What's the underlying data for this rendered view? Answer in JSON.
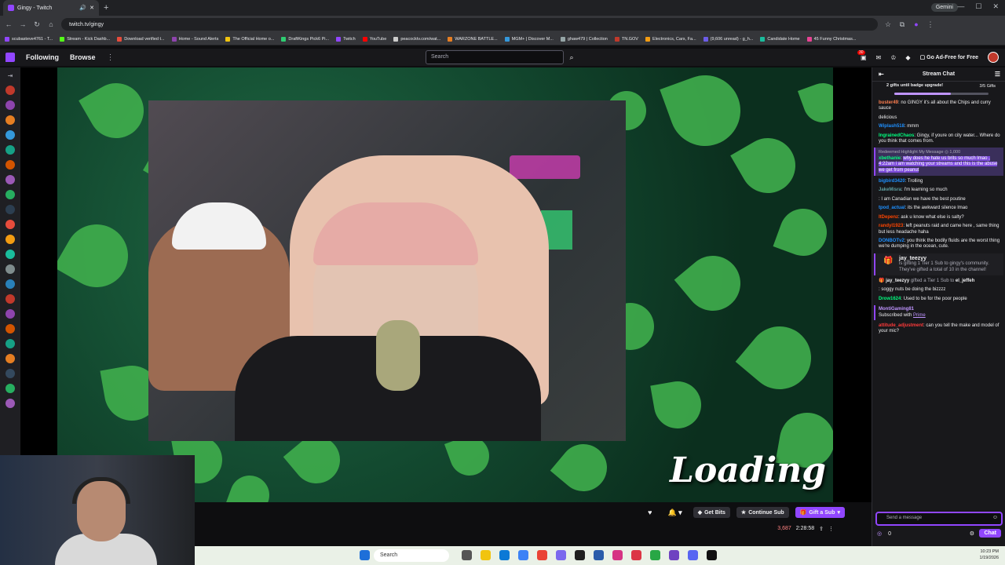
{
  "browser": {
    "tab_title": "Gingy - Twitch",
    "new_tab": "+",
    "gemini": "Gemini",
    "url": "twitch.tv/gingy",
    "bookmarks": [
      {
        "label": "scubasteve4761 - T...",
        "color": "#9146ff"
      },
      {
        "label": "Stream - Kick Dashb...",
        "color": "#53fc18"
      },
      {
        "label": "Download verified t...",
        "color": "#e74c3c"
      },
      {
        "label": "Home - Sound Alerts",
        "color": "#8e44ad"
      },
      {
        "label": "The Official Home o...",
        "color": "#f1c40f"
      },
      {
        "label": "DraftKings Pick6 Pi...",
        "color": "#2ecc71"
      },
      {
        "label": "Twitch",
        "color": "#9146ff"
      },
      {
        "label": "YouTube",
        "color": "#ff0000"
      },
      {
        "label": "peacocktv.com/wat...",
        "color": "#cccccc"
      },
      {
        "label": "WARZONE BATTLE...",
        "color": "#e67e22"
      },
      {
        "label": "MGM+ | Discover M...",
        "color": "#3498db"
      },
      {
        "label": "ghaw479 | Collection",
        "color": "#95a5a6"
      },
      {
        "label": "TN.GOV",
        "color": "#c0392b"
      },
      {
        "label": "Electronics, Cars, Fa...",
        "color": "#f39c12"
      },
      {
        "label": "(9,606 unread) - g_h...",
        "color": "#6c5ce7"
      },
      {
        "label": "Candidate Home",
        "color": "#1abc9c"
      },
      {
        "label": "45 Funny Christmas...",
        "color": "#e84393"
      }
    ]
  },
  "twitch_nav": {
    "following": "Following",
    "browse": "Browse",
    "more": "⋮",
    "search_placeholder": "Search",
    "notif_count": "30",
    "ad_free": "Go Ad-Free for Free"
  },
  "stream": {
    "overlay_text": "Loading Raid.."
  },
  "controls": {
    "get_bits": "Get Bits",
    "continue_sub": "Continue Sub",
    "gift_sub": "Gift a Sub",
    "viewers": "3,687",
    "uptime": "2:28:58"
  },
  "chat": {
    "title": "Stream Chat",
    "gift_goal": "2 gifts until badge upgrade!",
    "gift_count": "3/5 Gifts",
    "messages": [
      {
        "user": "buster49",
        "color": "#ff7f50",
        "text": ": no GINGY it's all about the Chips and curry sauce"
      },
      {
        "user": "",
        "color": "#ff3a3a",
        "text": "delicious"
      },
      {
        "user": "Wiplash518",
        "color": "#1e90ff",
        "text": ": mmm"
      },
      {
        "user": "IngrainedChaos",
        "color": "#00ff7f",
        "text": ": Gingy, if youre on city water... Where do you think that comes from."
      },
      {
        "user": "bigbird3420",
        "color": "#1e90ff",
        "text": ": Trolling"
      },
      {
        "user": "JakeMisra",
        "color": "#5f9ea0",
        "text": ": I'm learning so much"
      },
      {
        "user": "",
        "color": "#b22222",
        "text": ": I am Canadian we have the best poutine"
      },
      {
        "user": "tpod_actual",
        "color": "#1e90ff",
        "text": ": its the awkward silence lmao"
      },
      {
        "user": "ItDepenz",
        "color": "#ff4500",
        "text": ": ask u know what else is salty?"
      },
      {
        "user": "randyl1923",
        "color": "#ff4500",
        "text": ": left peanuts raid and came here , same thing but less headache haha"
      },
      {
        "user": "DONBOTv2",
        "color": "#1e90ff",
        "text": ": you think the bodily fluids are the worst thing we're dumping in the ocean, cute."
      }
    ],
    "highlight": {
      "label": "Redeemed Highlight My Message",
      "cost": "1,000",
      "user": "xbethanie",
      "text": "why does he hate us brits so much lmao , 4:22am i am watching your streams and this is the abuse we get from peanut"
    },
    "gift": {
      "user": "jay_teezyy",
      "text": "is gifting 1 Tier 1 Sub to gingy's community. They've gifted a total of 10 in the channel!"
    },
    "gifted": {
      "user": "jay_teezyy",
      "text": "gifted a Tier 1 Sub to",
      "target": "el_jeffeh"
    },
    "after": [
      {
        "user": "",
        "color": "#ff3a3a",
        "text": ": soggy nuts be doing the bizzzz"
      },
      {
        "user": "Drow1624",
        "color": "#00ff7f",
        "text": ": Used to be for the poor people"
      }
    ],
    "sub": {
      "user": "MontiGaming81",
      "text": "Subscribed with",
      "with": "Prime"
    },
    "last": {
      "user": "attitude_adjustment",
      "color": "#ff3a3a",
      "text": ": can you tell the make and model of your mic?"
    },
    "input_placeholder": "Send a message",
    "points": "0",
    "chat_button": "Chat"
  },
  "taskbar": {
    "search": "Search",
    "time": "10:23 PM",
    "date": "1/19/2026"
  }
}
